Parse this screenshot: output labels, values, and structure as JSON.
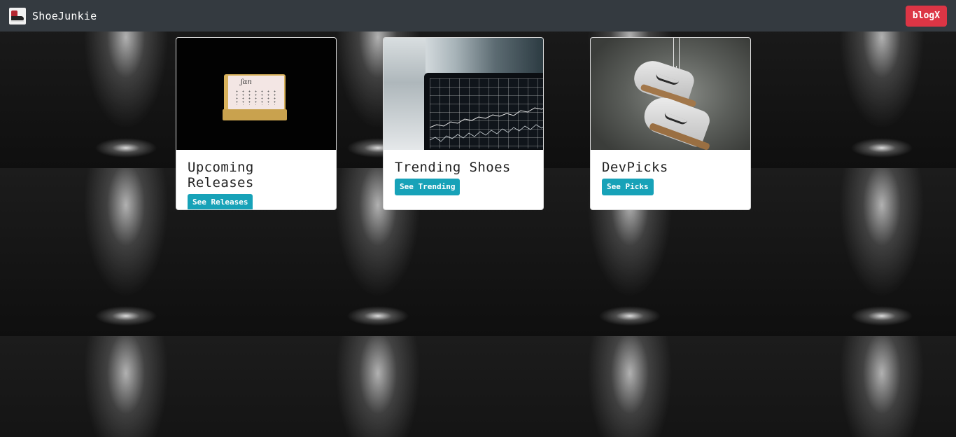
{
  "navbar": {
    "brand_name": "ShoeJunkie",
    "logo_icon": "sneaker-logo-icon",
    "blog_button_label": "blogX",
    "blog_button_color": "#dc3545",
    "background_color": "#343a40"
  },
  "cards": [
    {
      "title": "Upcoming Releases",
      "button_label": "See Releases",
      "image": "calendar-image"
    },
    {
      "title": "Trending Shoes",
      "button_label": "See Trending",
      "image": "stock-chart-image"
    },
    {
      "title": "DevPicks",
      "button_label": "See Picks",
      "image": "hanging-sneakers-image"
    }
  ],
  "colors": {
    "card_button": "#17a2b8",
    "card_background": "#ffffff",
    "page_background": "#131313"
  }
}
